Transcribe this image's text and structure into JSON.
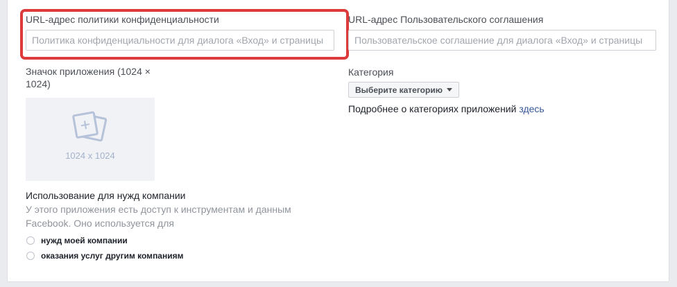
{
  "privacy": {
    "label": "URL-адрес политики конфиденциальности",
    "placeholder": "Политика конфиденциальности для диалога «Вход» и страницы"
  },
  "terms": {
    "label": "URL-адрес Пользовательского соглашения",
    "placeholder": "Пользовательское соглашение для диалога «Вход» и страницы"
  },
  "app_icon": {
    "label_line1": "Значок приложения (1024 ×",
    "label_line2": "1024)",
    "size_text": "1024 x 1024"
  },
  "category": {
    "label": "Категория",
    "dropdown_label": "Выберите категорию",
    "more_text": "Подробнее о категориях приложений ",
    "more_link": "здесь"
  },
  "business_use": {
    "label": "Использование для нужд компании",
    "description_line1": "У этого приложения есть доступ к инструментам и данным",
    "description_line2": "Facebook. Оно используется для",
    "options": [
      {
        "label": "нужд моей компании"
      },
      {
        "label": "оказания услуг другим компаниям"
      }
    ]
  },
  "colors": {
    "highlight": "#dd3b3b",
    "link": "#365899"
  }
}
